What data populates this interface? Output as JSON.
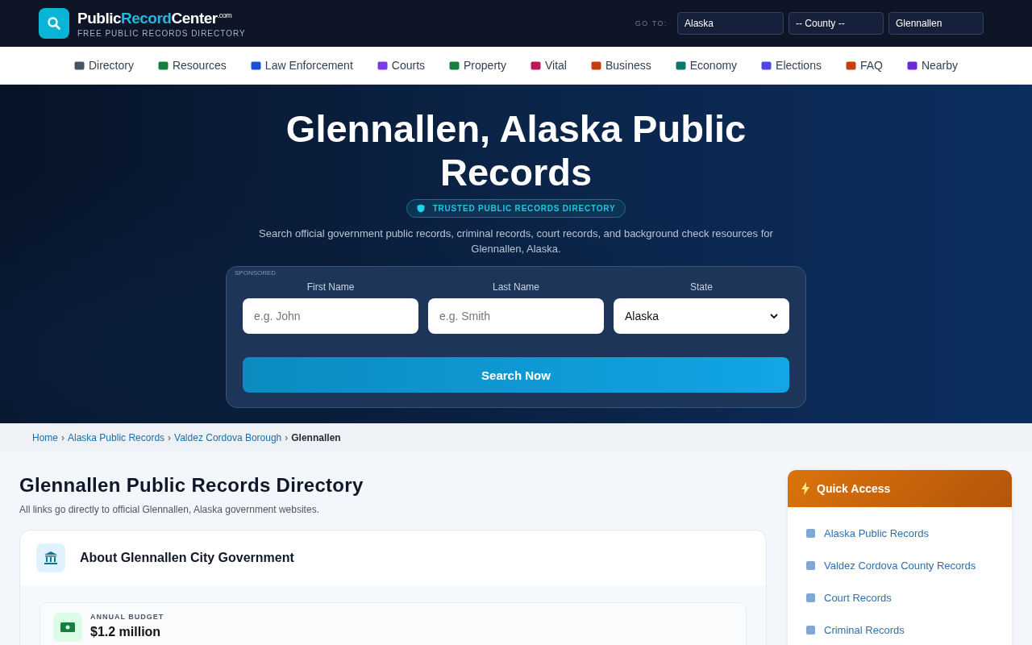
{
  "header": {
    "logo_parts": [
      {
        "text": "Public",
        "accent": false
      },
      {
        "text": "Record",
        "accent": true
      },
      {
        "text": "Center",
        "accent": false
      }
    ],
    "logo_suffix": ".com",
    "tagline": "FREE PUBLIC RECORDS DIRECTORY",
    "goto_label": "GO TO:",
    "goto_selects": [
      "Alaska",
      "-- County --",
      "Glennallen"
    ]
  },
  "nav": [
    {
      "label": "Directory",
      "color": "#475569"
    },
    {
      "label": "Resources",
      "color": "#15803d"
    },
    {
      "label": "Law Enforcement",
      "color": "#1d4ed8"
    },
    {
      "label": "Courts",
      "color": "#7c3aed"
    },
    {
      "label": "Property",
      "color": "#15803d"
    },
    {
      "label": "Vital",
      "color": "#be185d"
    },
    {
      "label": "Business",
      "color": "#c2410c"
    },
    {
      "label": "Economy",
      "color": "#0f766e"
    },
    {
      "label": "Elections",
      "color": "#4f46e5"
    },
    {
      "label": "FAQ",
      "color": "#c2410c"
    },
    {
      "label": "Nearby",
      "color": "#6d28d9"
    }
  ],
  "hero": {
    "title": "Glennallen, Alaska Public Records",
    "badge": "TRUSTED PUBLIC RECORDS DIRECTORY",
    "description": "Search official government public records, criminal records, court records, and background check resources for Glennallen, Alaska.",
    "search": {
      "sponsored": "SPONSORED",
      "fields": [
        {
          "label": "First Name",
          "kind": "input",
          "placeholder": "e.g. John"
        },
        {
          "label": "Last Name",
          "kind": "input",
          "placeholder": "e.g. Smith"
        },
        {
          "label": "State",
          "kind": "select",
          "value": "Alaska"
        }
      ],
      "button": "Search Now"
    }
  },
  "breadcrumb_separator": "›",
  "breadcrumb": [
    {
      "label": "Home",
      "current": false
    },
    {
      "label": "Alaska Public Records",
      "current": false
    },
    {
      "label": "Valdez Cordova Borough",
      "current": false
    },
    {
      "label": "Glennallen",
      "current": true
    }
  ],
  "main": {
    "title": "Glennallen Public Records Directory",
    "subtitle": "All links go directly to official Glennallen, Alaska government websites.",
    "card": {
      "title": "About Glennallen City Government",
      "stat_label": "ANNUAL BUDGET",
      "stat_value": "$1.2 million"
    }
  },
  "sidebar": {
    "title": "Quick Access",
    "links": [
      "Alaska Public Records",
      "Valdez Cordova County Records",
      "Court Records",
      "Criminal Records"
    ]
  }
}
